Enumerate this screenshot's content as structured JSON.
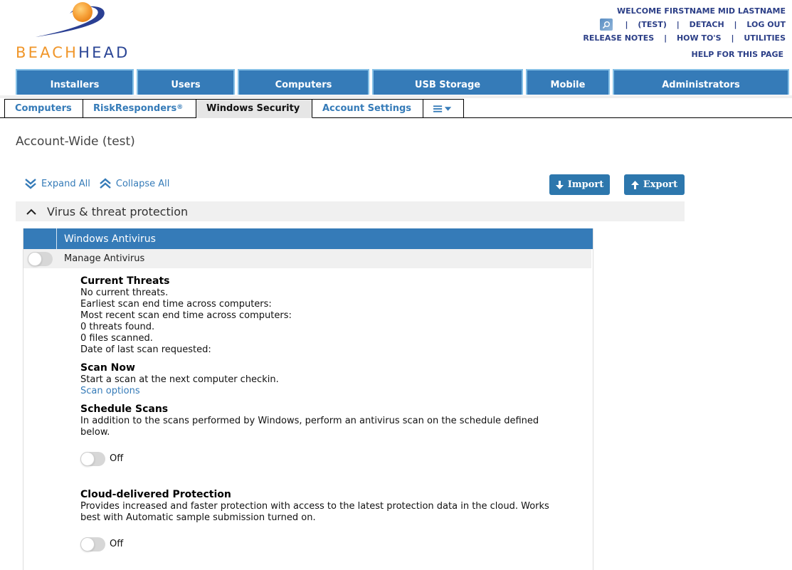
{
  "brand": {
    "part1": "BEACH",
    "part2": "HEAD",
    "orange": "#f0962a",
    "navy": "#2a4595"
  },
  "toplinks": {
    "welcome": "WELCOME FIRSTNAME MID LASTNAME",
    "search_icon": "search-icon",
    "account": "(TEST)",
    "detach": "DETACH",
    "logout": "LOG OUT",
    "release_notes": "RELEASE NOTES",
    "howtos": "HOW TO'S",
    "utilities": "UTILITIES",
    "help": "HELP FOR THIS PAGE",
    "separator": "|"
  },
  "mainnav": [
    {
      "label": "Installers"
    },
    {
      "label": "Users"
    },
    {
      "label": "Computers"
    },
    {
      "label": "USB Storage"
    },
    {
      "label": "Mobile"
    },
    {
      "label": "Administrators"
    }
  ],
  "subtabs": [
    {
      "label": "Computers",
      "active": false
    },
    {
      "label": "RiskResponders",
      "sup": "®",
      "active": false
    },
    {
      "label": "Windows Security",
      "active": true
    },
    {
      "label": "Account Settings",
      "active": false
    },
    {
      "label": "☰▾",
      "icon": "menu-icon",
      "active": false
    }
  ],
  "page": {
    "title": "Account-Wide (test)",
    "expand_all": "Expand All",
    "collapse_all": "Collapse All",
    "import_label": "Import",
    "export_label": "Export",
    "accent": "#357bb8"
  },
  "section": {
    "title": "Virus & threat protection",
    "expanded": true,
    "panel": {
      "title": "Windows Antivirus",
      "manage_label": "Manage Antivirus",
      "manage_on": false,
      "current_threats": {
        "heading": "Current Threats",
        "lines": [
          "No current threats.",
          "Earliest scan end time across computers:",
          "Most recent scan end time across computers:",
          "0 threats found.",
          "0 files scanned.",
          "Date of last scan requested:"
        ]
      },
      "scan_now": {
        "heading": "Scan Now",
        "text": "Start a scan at the next computer checkin.",
        "link": "Scan options"
      },
      "schedule_scans": {
        "heading": "Schedule Scans",
        "text": "In addition to the scans performed by Windows, perform an antivirus scan on the schedule defined below.",
        "state": "Off"
      },
      "cloud_protection": {
        "heading": "Cloud-delivered Protection",
        "text": "Provides increased and faster protection with access to the latest protection data in the cloud. Works best with Automatic sample submission turned on.",
        "state": "Off"
      }
    }
  }
}
